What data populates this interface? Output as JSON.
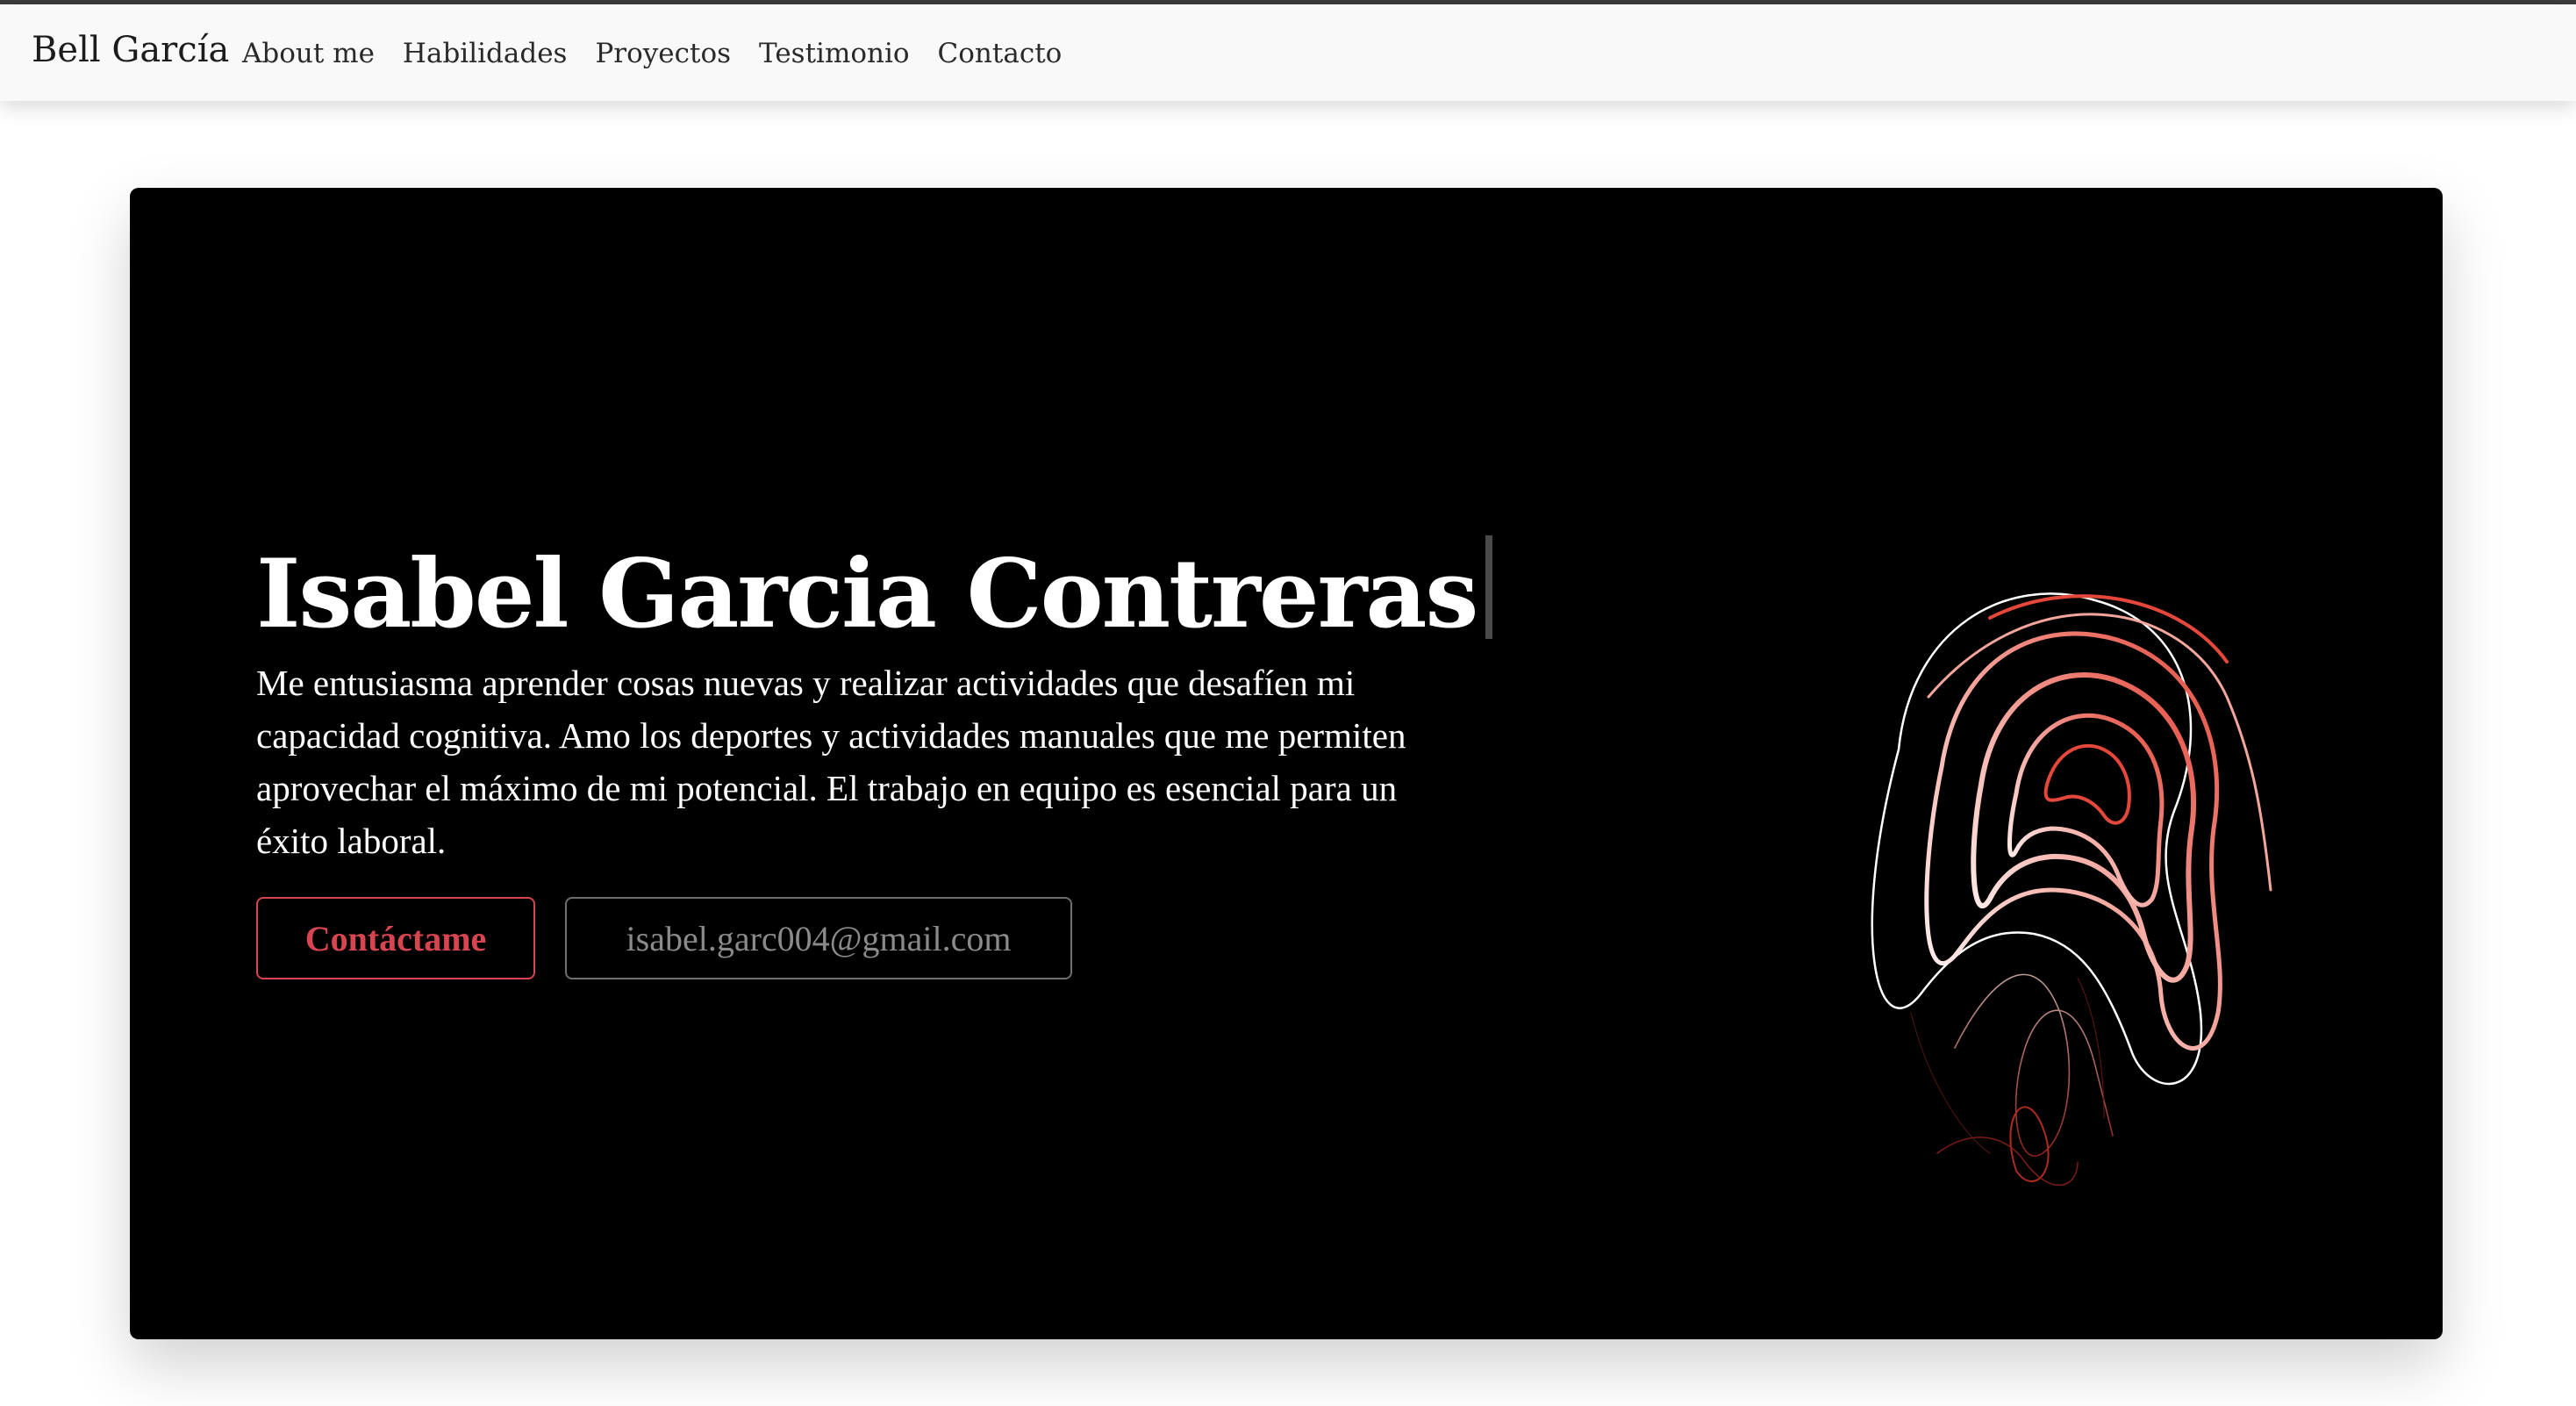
{
  "navbar": {
    "brand": "Bell García",
    "links": [
      "About me",
      "Habilidades",
      "Proyectos",
      "Testimonio",
      "Contacto"
    ]
  },
  "hero": {
    "title": "Isabel Garcia Contreras",
    "description": "Me entusiasma aprender cosas nuevas y realizar actividades que desafíen mi capacidad cognitiva. Amo los deportes y actividades manuales que me permiten aprovechar el máximo de mi potencial. El trabajo en equipo es esencial para un éxito laboral.",
    "contact_button": "Contáctame",
    "email_button": "isabel.garc004@gmail.com"
  },
  "colors": {
    "accent": "#d64550",
    "card_background": "#000000",
    "navbar_background": "#f9f9f9"
  },
  "icons": {
    "hero_art": "abstract-gradient-line-art"
  }
}
